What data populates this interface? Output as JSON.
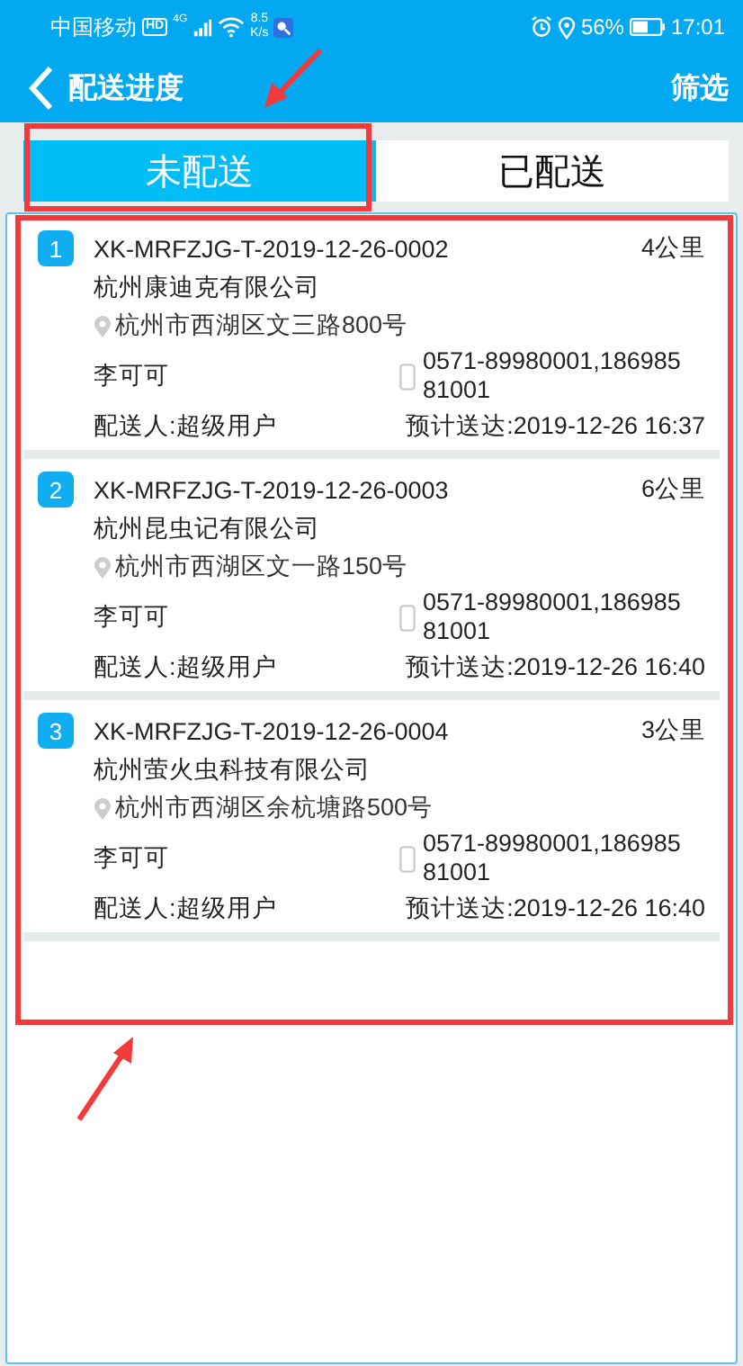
{
  "status_bar": {
    "carrier": "中国移动",
    "hd": "HD",
    "network": "4G",
    "speed_value": "8.5",
    "speed_unit": "K/s",
    "battery": "56%",
    "time": "17:01"
  },
  "header": {
    "title": "配送进度",
    "action": "筛选"
  },
  "tabs": [
    {
      "label": "未配送",
      "selected": true
    },
    {
      "label": "已配送",
      "selected": false
    }
  ],
  "orders": [
    {
      "index": "1",
      "code": "XK-MRFZJG-T-2019-12-26-0002",
      "distance": "4公里",
      "company": "杭州康迪克有限公司",
      "address": "杭州市西湖区文三路800号",
      "contact": "李可可",
      "phone": "0571-89980001,18698581001",
      "courier": "配送人:超级用户",
      "eta": "预计送达:2019-12-26 16:37"
    },
    {
      "index": "2",
      "code": "XK-MRFZJG-T-2019-12-26-0003",
      "distance": "6公里",
      "company": "杭州昆虫记有限公司",
      "address": "杭州市西湖区文一路150号",
      "contact": "李可可",
      "phone": "0571-89980001,18698581001",
      "courier": "配送人:超级用户",
      "eta": "预计送达:2019-12-26 16:40"
    },
    {
      "index": "3",
      "code": "XK-MRFZJG-T-2019-12-26-0004",
      "distance": "3公里",
      "company": "杭州萤火虫科技有限公司",
      "address": "杭州市西湖区余杭塘路500号",
      "contact": "李可可",
      "phone": "0571-89980001,18698581001",
      "courier": "配送人:超级用户",
      "eta": "预计送达:2019-12-26 16:40"
    }
  ]
}
